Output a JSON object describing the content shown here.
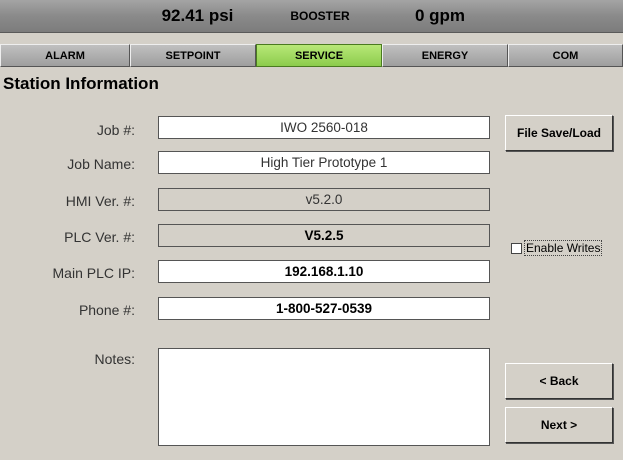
{
  "status": {
    "pressure": "92.41 psi",
    "mode": "BOOSTER",
    "flow": "0 gpm"
  },
  "tabs": [
    {
      "label": "ALARM"
    },
    {
      "label": "SETPOINT"
    },
    {
      "label": "SERVICE",
      "active": true
    },
    {
      "label": "ENERGY"
    },
    {
      "label": "COM"
    }
  ],
  "section_title": "Station Information",
  "fields": {
    "job_number": {
      "label": "Job #:",
      "value": "IWO 2560-018"
    },
    "job_name": {
      "label": "Job Name:",
      "value": "High Tier Prototype 1"
    },
    "hmi_version": {
      "label": "HMI Ver. #:",
      "value": "v5.2.0"
    },
    "plc_version": {
      "label": "PLC Ver. #:",
      "value": "V5.2.5"
    },
    "main_plc_ip": {
      "label": "Main PLC IP:",
      "value": "192.168.1.10"
    },
    "phone": {
      "label": "Phone #:",
      "value": "1-800-527-0539"
    },
    "notes": {
      "label": "Notes:",
      "value": ""
    }
  },
  "buttons": {
    "file_save_load": "File Save/Load",
    "back": "< Back",
    "next": "Next >"
  },
  "enable_writes": {
    "label": "Enable Writes",
    "checked": false
  },
  "colors": {
    "active_tab": "#a6dc60",
    "background": "#d4d0c8"
  }
}
